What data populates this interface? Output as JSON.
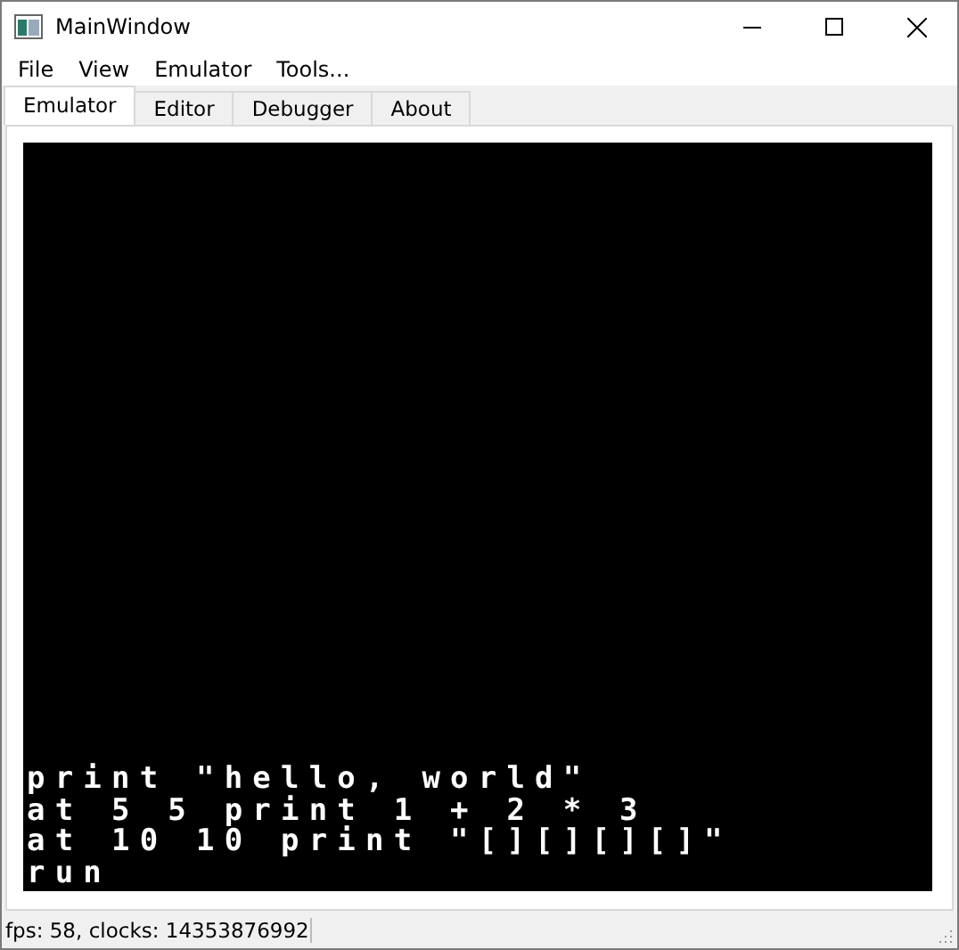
{
  "window": {
    "title": "MainWindow"
  },
  "menu": [
    "File",
    "View",
    "Emulator",
    "Tools..."
  ],
  "tabs": [
    {
      "label": "Emulator",
      "selected": true
    },
    {
      "label": "Editor",
      "selected": false
    },
    {
      "label": "Debugger",
      "selected": false
    },
    {
      "label": "About",
      "selected": false
    }
  ],
  "screen": {
    "lines": [
      "print \"hello, world\"",
      "at 5 5 print 1 + 2 * 3",
      "at 10 10 print \"[][][][]\"",
      "run"
    ]
  },
  "status_bar": "fps: 58, clocks: 14353876992"
}
